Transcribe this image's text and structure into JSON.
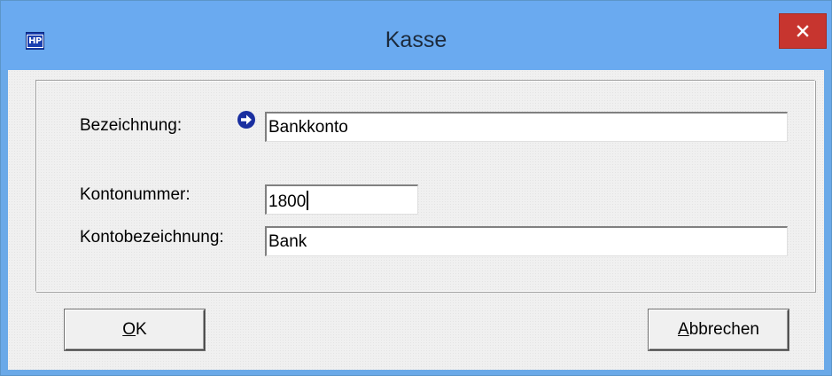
{
  "window": {
    "title": "Kasse",
    "app_icon_text": "HP",
    "close_icon": "close-icon"
  },
  "form": {
    "bezeichnung_label": "Bezeichnung:",
    "bezeichnung_value": "Bankkonto",
    "kontonummer_label": "Kontonummer:",
    "kontonummer_value": "1800",
    "kontobezeichnung_label": "Kontobezeichnung:",
    "kontobezeichnung_value": "Bank",
    "focus_indicator_icon": "arrow-right-circle-icon"
  },
  "buttons": {
    "ok_accel": "O",
    "ok_rest": "K",
    "cancel_accel": "A",
    "cancel_rest": "bbrechen"
  },
  "colors": {
    "titlebar": "#6aaaf0",
    "close_button": "#c7352f",
    "client_background": "#f0f0f0",
    "focus_arrow": "#1a2fa0"
  }
}
